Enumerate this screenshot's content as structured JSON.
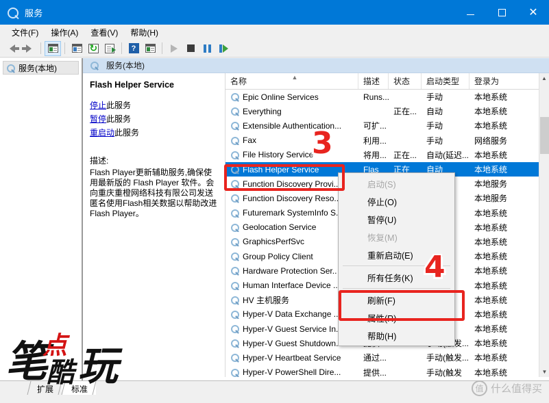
{
  "window": {
    "title": "服务",
    "icon": "services-gear-icon",
    "minimize": "minimize-icon",
    "maximize": "maximize-icon",
    "close": "close-icon",
    "accent_color": "#0078d7"
  },
  "menubar": {
    "items": [
      {
        "label": "文件(F)",
        "name": "menu-file"
      },
      {
        "label": "操作(A)",
        "name": "menu-action"
      },
      {
        "label": "查看(V)",
        "name": "menu-view"
      },
      {
        "label": "帮助(H)",
        "name": "menu-help"
      }
    ]
  },
  "toolbar": {
    "buttons": [
      {
        "name": "back-arrow-icon"
      },
      {
        "name": "forward-arrow-icon"
      },
      {
        "name": "show-hide-tree-icon"
      },
      {
        "name": "properties-icon"
      },
      {
        "name": "refresh-icon"
      },
      {
        "name": "export-list-icon"
      },
      {
        "name": "help-icon"
      },
      {
        "name": "new-window-icon"
      },
      {
        "name": "start-service-icon"
      },
      {
        "name": "stop-service-icon"
      },
      {
        "name": "pause-service-icon"
      },
      {
        "name": "restart-service-icon"
      }
    ]
  },
  "sidebar": {
    "items": [
      {
        "label": "服务(本地)",
        "name": "sidebar-item-services-local"
      }
    ]
  },
  "detail": {
    "header": "服务(本地)",
    "service_name": "Flash Helper Service",
    "actions": [
      {
        "link": "停止",
        "suffix": "此服务",
        "name": "stop-service-link"
      },
      {
        "link": "暂停",
        "suffix": "此服务",
        "name": "pause-service-link"
      },
      {
        "link": "重启动",
        "suffix": "此服务",
        "name": "restart-service-link"
      }
    ],
    "description_label": "描述:",
    "description": "Flash Player更新辅助服务,确保使用最新版的 Flash Player 软件。会向重庆重橙网络科技有限公司发送匿名使用Flash相关数据以帮助改进 Flash Player。"
  },
  "list": {
    "columns": [
      {
        "label": "名称",
        "name": "column-name"
      },
      {
        "label": "描述",
        "name": "column-description"
      },
      {
        "label": "状态",
        "name": "column-status"
      },
      {
        "label": "启动类型",
        "name": "column-startup-type"
      },
      {
        "label": "登录为",
        "name": "column-log-on-as"
      }
    ],
    "sort_indicator": "▲",
    "rows": [
      {
        "name": "Epic Online Services",
        "desc": "Runs...",
        "status": "",
        "startup": "手动",
        "logon": "本地系统",
        "selected": false
      },
      {
        "name": "Everything",
        "desc": "",
        "status": "正在...",
        "startup": "自动",
        "logon": "本地系统",
        "selected": false
      },
      {
        "name": "Extensible Authentication...",
        "desc": "可扩...",
        "status": "",
        "startup": "手动",
        "logon": "本地系统",
        "selected": false
      },
      {
        "name": "Fax",
        "desc": "利用...",
        "status": "",
        "startup": "手动",
        "logon": "网络服务",
        "selected": false
      },
      {
        "name": "File History Service",
        "desc": "将用...",
        "status": "正在...",
        "startup": "自动(延迟...",
        "logon": "本地系统",
        "selected": false
      },
      {
        "name": "Flash Helper Service",
        "desc": "Flas",
        "status": "正在",
        "startup": "自动",
        "logon": "本地系统",
        "selected": true
      },
      {
        "name": "Function Discovery Provi...",
        "desc": "",
        "status": "",
        "startup": "",
        "logon": "本地服务",
        "selected": false
      },
      {
        "name": "Function Discovery Reso...",
        "desc": "",
        "status": "",
        "startup": "发...",
        "logon": "本地服务",
        "selected": false
      },
      {
        "name": "Futuremark SystemInfo S..",
        "desc": "",
        "status": "",
        "startup": "",
        "logon": "本地系统",
        "selected": false
      },
      {
        "name": "Geolocation Service",
        "desc": "",
        "status": "",
        "startup": "发...",
        "logon": "本地系统",
        "selected": false
      },
      {
        "name": "GraphicsPerfSvc",
        "desc": "",
        "status": "",
        "startup": "发...",
        "logon": "本地系统",
        "selected": false
      },
      {
        "name": "Group Policy Client",
        "desc": "",
        "status": "",
        "startup": "发...",
        "logon": "本地系统",
        "selected": false
      },
      {
        "name": "Hardware Protection Ser..",
        "desc": "",
        "status": "",
        "startup": "",
        "logon": "本地系统",
        "selected": false
      },
      {
        "name": "Human Interface Device ...",
        "desc": "",
        "status": "",
        "startup": "发...",
        "logon": "本地系统",
        "selected": false
      },
      {
        "name": "HV 主机服务",
        "desc": "",
        "status": "",
        "startup": "发...",
        "logon": "本地系统",
        "selected": false
      },
      {
        "name": "Hyper-V Data Exchange ...",
        "desc": "",
        "status": "",
        "startup": "发...",
        "logon": "本地系统",
        "selected": false
      },
      {
        "name": "Hyper-V Guest Service In...",
        "desc": "",
        "status": "",
        "startup": "发...",
        "logon": "本地系统",
        "selected": false
      },
      {
        "name": "Hyper-V Guest Shutdown...",
        "desc": "提供...",
        "status": "",
        "startup": "手动(触发...",
        "logon": "本地系统",
        "selected": false
      },
      {
        "name": "Hyper-V Heartbeat Service",
        "desc": "通过...",
        "status": "",
        "startup": "手动(触发...",
        "logon": "本地系统",
        "selected": false
      },
      {
        "name": "Hyper-V PowerShell Dire...",
        "desc": "提供...",
        "status": "",
        "startup": "手动(触发",
        "logon": "本地系统",
        "selected": false
      }
    ]
  },
  "context_menu": {
    "items": [
      {
        "label": "启动(S)",
        "name": "ctx-start",
        "disabled": true,
        "separator_after": false
      },
      {
        "label": "停止(O)",
        "name": "ctx-stop",
        "disabled": false,
        "separator_after": false
      },
      {
        "label": "暂停(U)",
        "name": "ctx-pause",
        "disabled": false,
        "separator_after": false
      },
      {
        "label": "恢复(M)",
        "name": "ctx-resume",
        "disabled": true,
        "separator_after": false
      },
      {
        "label": "重新启动(E)",
        "name": "ctx-restart",
        "disabled": false,
        "separator_after": true
      },
      {
        "label": "所有任务(K)",
        "name": "ctx-all-tasks",
        "disabled": false,
        "separator_after": true
      },
      {
        "label": "刷新(F)",
        "name": "ctx-refresh",
        "disabled": false,
        "separator_after": false
      },
      {
        "label": "属性(R)",
        "name": "ctx-properties",
        "disabled": false,
        "separator_after": false
      },
      {
        "label": "帮助(H)",
        "name": "ctx-help",
        "disabled": false,
        "separator_after": false
      }
    ]
  },
  "annotations": [
    {
      "label": "3",
      "name": "annotation-marker-3",
      "color": "#e8241f"
    },
    {
      "label": "4",
      "name": "annotation-marker-4",
      "color": "#e8241f"
    }
  ],
  "tabs": [
    {
      "label": "扩展",
      "name": "tab-extended",
      "active": false
    },
    {
      "label": "标准",
      "name": "tab-standard",
      "active": true
    }
  ],
  "watermark": {
    "char1": "笔",
    "char2": "点",
    "char3": "酷",
    "char4": "玩",
    "badge": "值",
    "text": "什么值得买"
  }
}
